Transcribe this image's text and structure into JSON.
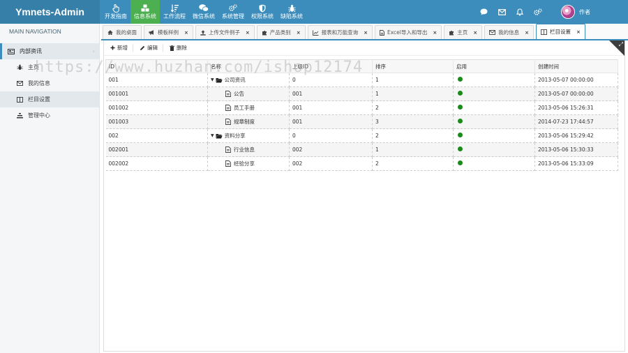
{
  "app": {
    "title": "Ymnets-Admin"
  },
  "topnav": {
    "items": [
      {
        "label": "开发指南",
        "icon": "hand-pointer-icon",
        "active": false
      },
      {
        "label": "信息系统",
        "icon": "cubes-icon",
        "active": true
      },
      {
        "label": "工作流程",
        "icon": "sort-amount-icon",
        "active": false
      },
      {
        "label": "微信系统",
        "icon": "wechat-icon",
        "active": false
      },
      {
        "label": "系统管理",
        "icon": "cogs-icon",
        "active": false
      },
      {
        "label": "权限系统",
        "icon": "shield-icon",
        "active": false
      },
      {
        "label": "缺陷系统",
        "icon": "bug-icon",
        "active": false
      }
    ]
  },
  "header_right": {
    "user_name": "作者"
  },
  "sidebar": {
    "header": "MAIN NAVIGATION",
    "group": {
      "label": "内部资讯",
      "icon": "newspaper-icon"
    },
    "items": [
      {
        "label": "主页",
        "icon": "bug-icon",
        "active": false
      },
      {
        "label": "我的信息",
        "icon": "envelope-icon",
        "active": false
      },
      {
        "label": "栏目设置",
        "icon": "columns-icon",
        "active": true
      },
      {
        "label": "管理中心",
        "icon": "bars-icon",
        "active": false
      }
    ]
  },
  "tabs": [
    {
      "label": "我的桌面",
      "icon": "home-icon",
      "closable": false,
      "active": false
    },
    {
      "label": "模板样例",
      "icon": "bullhorn-icon",
      "closable": true,
      "active": false
    },
    {
      "label": "上传文件例子",
      "icon": "upload-icon",
      "closable": true,
      "active": false
    },
    {
      "label": "产品类别",
      "icon": "puzzle-icon",
      "closable": true,
      "active": false
    },
    {
      "label": "报表和万能查询",
      "icon": "chart-icon",
      "closable": true,
      "active": false
    },
    {
      "label": "Excel导入和导出",
      "icon": "file-icon",
      "closable": true,
      "active": false
    },
    {
      "label": "主页",
      "icon": "puzzle-icon",
      "closable": true,
      "active": false
    },
    {
      "label": "我的信息",
      "icon": "envelope-icon",
      "closable": true,
      "active": false
    },
    {
      "label": "栏目设置",
      "icon": "columns-icon",
      "closable": true,
      "active": true
    }
  ],
  "toolbar": {
    "add": "新增",
    "edit": "编辑",
    "delete": "删除"
  },
  "table": {
    "columns": [
      "ID",
      "名称",
      "上级ID",
      "排序",
      "启用",
      "创建时间"
    ],
    "rows": [
      {
        "id": "001",
        "name": "公司资讯",
        "parent": "0",
        "sort": "1",
        "enabled": true,
        "created": "2013-05-07 00:00:00",
        "level": 0
      },
      {
        "id": "001001",
        "name": "公告",
        "parent": "001",
        "sort": "1",
        "enabled": true,
        "created": "2013-05-07 00:00:00",
        "level": 1
      },
      {
        "id": "001002",
        "name": "员工手册",
        "parent": "001",
        "sort": "2",
        "enabled": true,
        "created": "2013-05-06 15:26:31",
        "level": 1
      },
      {
        "id": "001003",
        "name": "规章制度",
        "parent": "001",
        "sort": "3",
        "enabled": true,
        "created": "2014-07-23 17:44:57",
        "level": 1
      },
      {
        "id": "002",
        "name": "资料分享",
        "parent": "0",
        "sort": "2",
        "enabled": true,
        "created": "2013-05-06 15:29:42",
        "level": 0
      },
      {
        "id": "002001",
        "name": "行业信息",
        "parent": "002",
        "sort": "1",
        "enabled": true,
        "created": "2013-05-06 15:30:33",
        "level": 1
      },
      {
        "id": "002002",
        "name": "经验分享",
        "parent": "002",
        "sort": "2",
        "enabled": true,
        "created": "2013-05-06 15:33:09",
        "level": 1
      }
    ]
  },
  "watermark": "https://www.huzhan.com/ishop12174",
  "colors": {
    "header": "#3c8dbc",
    "brand": "#367fa9",
    "active_nav": "#4caf50",
    "enabled_dot": "#1a8a1a"
  }
}
